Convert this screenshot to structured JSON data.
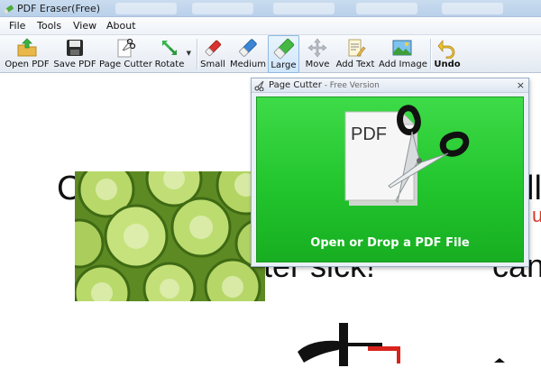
{
  "window": {
    "title": "PDF Eraser(Free)"
  },
  "menu": {
    "items": [
      "File",
      "Tools",
      "View",
      "About"
    ]
  },
  "toolbar": {
    "open_pdf": "Open PDF",
    "save_pdf": "Save PDF",
    "page_cutter": "Page Cutter",
    "rotate": "Rotate",
    "small": "Small",
    "medium": "Medium",
    "large": "Large",
    "move": "Move",
    "add_text": "Add Text",
    "add_image": "Add Image",
    "undo": "Undo",
    "active_tool": "large",
    "icons": [
      "open-folder-icon",
      "save-disk-icon",
      "scissors-page-icon",
      "rotate-arrows-icon",
      "eraser-small-icon",
      "eraser-medium-icon",
      "eraser-large-icon",
      "move-arrows-icon",
      "add-text-icon",
      "add-image-icon",
      "undo-arrow-icon"
    ]
  },
  "page_cutter": {
    "title": "Page Cutter",
    "subtitle": " - Free Version",
    "close": "×",
    "drop_text": "Open or Drop a PDF File",
    "pdf_glyph": "PDF",
    "colors": {
      "green_top": "#3edb48",
      "green_bottom": "#17ae21"
    }
  },
  "document": {
    "fragments": {
      "left_letter": "C",
      "right_letter": "ll",
      "right_red": "ur",
      "mid_line": "ter sick!",
      "right_line": "can"
    }
  }
}
